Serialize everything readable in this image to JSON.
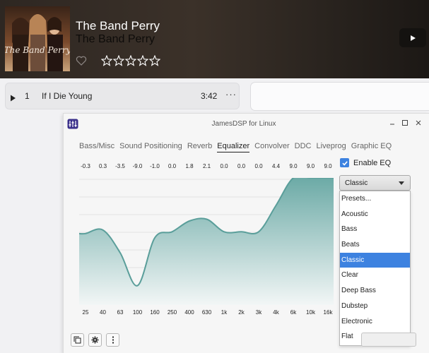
{
  "album": {
    "title": "The Band Perry",
    "artist": "The Band Perry",
    "rating": 0,
    "max_rating": 5,
    "art_text": "The Band Perry"
  },
  "track": {
    "number": "1",
    "title": "If I Die Young",
    "duration": "3:42",
    "menu": "···"
  },
  "window": {
    "title": "JamesDSP for Linux"
  },
  "tabs": [
    {
      "label": "Bass/Misc"
    },
    {
      "label": "Sound Positioning"
    },
    {
      "label": "Reverb"
    },
    {
      "label": "Equalizer"
    },
    {
      "label": "Convolver"
    },
    {
      "label": "DDC"
    },
    {
      "label": "Liveprog"
    },
    {
      "label": "Graphic EQ"
    }
  ],
  "active_tab": "Equalizer",
  "eq": {
    "enable_label": "Enable EQ",
    "enabled": true,
    "value_labels": [
      "-0.3",
      "0.3",
      "-3.5",
      "-9.0",
      "-1.0",
      "0.0",
      "1.8",
      "2.1",
      "0.0",
      "0.0",
      "0.0",
      "4.4",
      "9.0",
      "9.0",
      "9.0"
    ],
    "freq_labels": [
      "25",
      "40",
      "63",
      "100",
      "160",
      "250",
      "400",
      "630",
      "1k",
      "2k",
      "3k",
      "4k",
      "6k",
      "10k",
      "16k"
    ],
    "preset_selected": "Classic",
    "presets": [
      "Presets...",
      "Acoustic",
      "Bass",
      "Beats",
      "Classic",
      "Clear",
      "Deep Bass",
      "Dubstep",
      "Electronic",
      "Flat"
    ]
  },
  "chart_data": {
    "type": "area",
    "title": "",
    "xlabel": "",
    "ylabel": "",
    "categories": [
      "25",
      "40",
      "63",
      "100",
      "160",
      "250",
      "400",
      "630",
      "1k",
      "2k",
      "3k",
      "4k",
      "6k",
      "10k",
      "16k"
    ],
    "values": [
      -0.3,
      0.3,
      -3.5,
      -9.0,
      -1.0,
      0.0,
      1.8,
      2.1,
      0.0,
      0.0,
      0.0,
      4.4,
      9.0,
      9.0,
      9.0
    ],
    "ylim": [
      -12,
      9
    ],
    "grid": true
  },
  "colors": {
    "accent": "#3d82e0",
    "curve": "#5a9e9a",
    "fill_top": "#6aa9a5",
    "fill_bottom": "#f2f6f6"
  }
}
